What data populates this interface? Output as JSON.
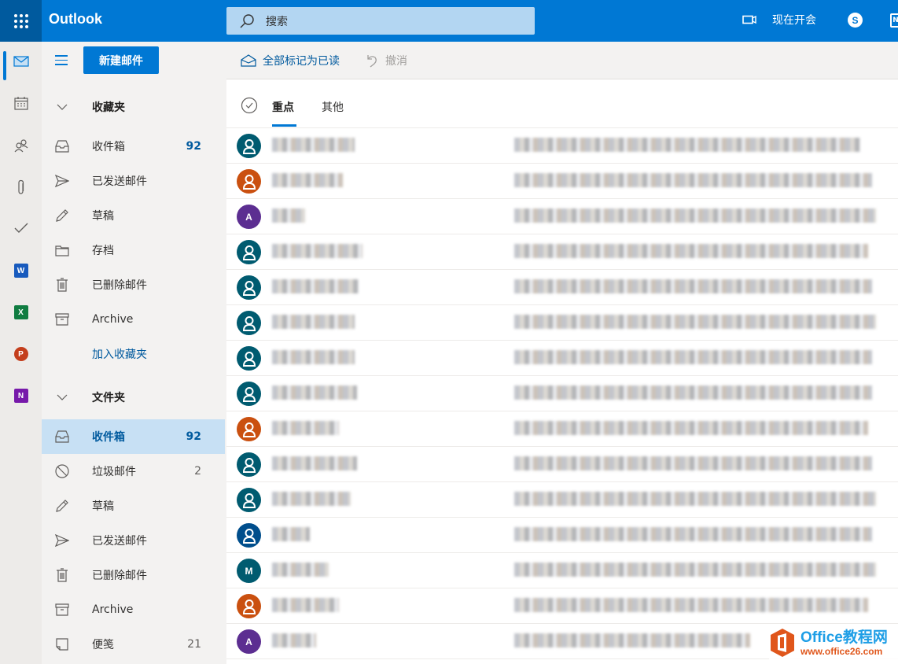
{
  "topbar": {
    "app_name": "Outlook",
    "search_placeholder": "搜索",
    "meet_now_label": "现在开会",
    "skype_label": "S",
    "onenote_label": "N"
  },
  "rail": {
    "items": [
      {
        "name": "mail",
        "active": true
      },
      {
        "name": "calendar"
      },
      {
        "name": "people"
      },
      {
        "name": "files"
      },
      {
        "name": "todo"
      },
      {
        "name": "word",
        "label": "W",
        "color": "#185abd"
      },
      {
        "name": "excel",
        "label": "X",
        "color": "#107c41"
      },
      {
        "name": "powerpoint",
        "label": "P",
        "color": "#c43e1c"
      },
      {
        "name": "onenote",
        "label": "N",
        "color": "#7719aa"
      }
    ]
  },
  "folders": {
    "new_mail_label": "新建邮件",
    "favorites_header": "收藏夹",
    "favorites": [
      {
        "icon": "inbox",
        "label": "收件箱",
        "count": "92",
        "bold": true
      },
      {
        "icon": "send",
        "label": "已发送邮件",
        "count": ""
      },
      {
        "icon": "pencil",
        "label": "草稿",
        "count": ""
      },
      {
        "icon": "folder",
        "label": "存档",
        "count": ""
      },
      {
        "icon": "trash",
        "label": "已删除邮件",
        "count": ""
      },
      {
        "icon": "archive",
        "label": "Archive",
        "count": ""
      }
    ],
    "add_favorite_label": "加入收藏夹",
    "folders_header": "文件夹",
    "folder_items": [
      {
        "icon": "inbox",
        "label": "收件箱",
        "count": "92",
        "bold": true,
        "selected": true
      },
      {
        "icon": "junk",
        "label": "垃圾邮件",
        "count": "2"
      },
      {
        "icon": "pencil",
        "label": "草稿",
        "count": ""
      },
      {
        "icon": "send",
        "label": "已发送邮件",
        "count": ""
      },
      {
        "icon": "trash",
        "label": "已删除邮件",
        "count": ""
      },
      {
        "icon": "archive",
        "label": "Archive",
        "count": ""
      },
      {
        "icon": "note",
        "label": "便笺",
        "count": "21"
      }
    ]
  },
  "command_bar": {
    "mark_all_read_label": "全部标记为已读",
    "undo_label": "撤消"
  },
  "message_list": {
    "tabs": [
      {
        "label": "重点",
        "active": true
      },
      {
        "label": "其他",
        "active": false
      }
    ],
    "messages": [
      {
        "avatar_type": "person",
        "avatar_color": "#005b70",
        "initial": ""
      },
      {
        "avatar_type": "person",
        "avatar_color": "#ca5010",
        "initial": ""
      },
      {
        "avatar_type": "initial",
        "avatar_color": "#5c2e91",
        "initial": "A"
      },
      {
        "avatar_type": "person",
        "avatar_color": "#005b70",
        "initial": ""
      },
      {
        "avatar_type": "person",
        "avatar_color": "#005b70",
        "initial": ""
      },
      {
        "avatar_type": "person",
        "avatar_color": "#005b70",
        "initial": ""
      },
      {
        "avatar_type": "person",
        "avatar_color": "#005b70",
        "initial": ""
      },
      {
        "avatar_type": "person",
        "avatar_color": "#005b70",
        "initial": ""
      },
      {
        "avatar_type": "person",
        "avatar_color": "#ca5010",
        "initial": ""
      },
      {
        "avatar_type": "person",
        "avatar_color": "#005b70",
        "initial": ""
      },
      {
        "avatar_type": "person",
        "avatar_color": "#005b70",
        "initial": ""
      },
      {
        "avatar_type": "person",
        "avatar_color": "#004e8c",
        "initial": ""
      },
      {
        "avatar_type": "initial",
        "avatar_color": "#005b70",
        "initial": "M"
      },
      {
        "avatar_type": "person",
        "avatar_color": "#ca5010",
        "initial": ""
      },
      {
        "avatar_type": "initial",
        "avatar_color": "#5c2e91",
        "initial": "A"
      }
    ],
    "content_obscured": true
  },
  "watermark": {
    "title": "Office教程网",
    "url": "www.office26.com"
  },
  "colors": {
    "brand": "#0078d4",
    "brand_dark": "#005a9e",
    "selected_folder": "#c7e0f4"
  }
}
